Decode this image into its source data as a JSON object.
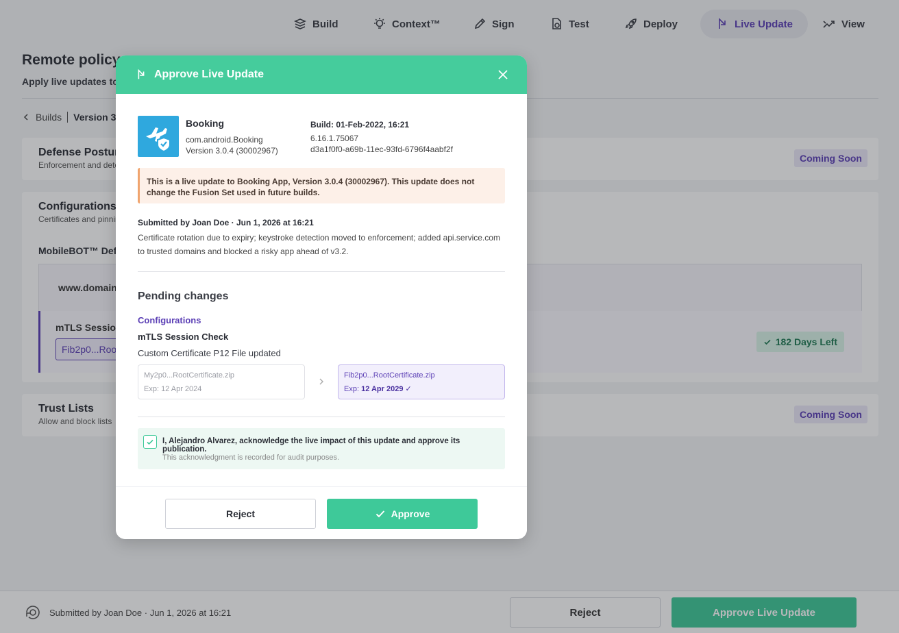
{
  "nav": {
    "items": [
      {
        "label": "Build",
        "icon": "build-icon"
      },
      {
        "label": "Context™",
        "icon": "bulb-icon"
      },
      {
        "label": "Sign",
        "icon": "pen-icon"
      },
      {
        "label": "Test",
        "icon": "test-icon"
      },
      {
        "label": "Deploy",
        "icon": "rocket-icon"
      },
      {
        "label": "Live Update",
        "icon": "live-update-icon",
        "active": true
      },
      {
        "label": "View",
        "icon": "view-icon"
      }
    ]
  },
  "page": {
    "title": "Remote policy m",
    "subtitle": "Apply live updates to c",
    "breadcrumb": {
      "back": "Builds",
      "current": "Version 3"
    }
  },
  "cards": {
    "defense": {
      "title": "Defense Posture",
      "subtitle": "Enforcement and dete",
      "badge": "Coming Soon"
    },
    "configs": {
      "title": "Configurations",
      "subtitle": "Certificates and pinnin",
      "section": "MobileBOT™ Defe",
      "domain": "www.domain-",
      "mtls_title": "mTLS Session",
      "mtls_file": "Fib2p0...Root",
      "days_left": "182 Days Left"
    },
    "trust": {
      "title": "Trust Lists",
      "subtitle": "Allow and block lists",
      "badge": "Coming Soon"
    }
  },
  "bottombar": {
    "submitted": "Submitted by Joan Doe · Jun 1, 2026 at 16:21",
    "reject": "Reject",
    "approve": "Approve Live Update"
  },
  "modal": {
    "title": "Approve Live Update",
    "app": {
      "name": "Booking",
      "package": "com.android.Booking",
      "version": "Version 3.0.4 (30002967)",
      "build_date": "Build: 01-Feb-2022, 16:21",
      "build_number": "6.16.1.75067",
      "build_id": "d3a1f0f0-a69b-11ec-93fd-6796f4aabf2f"
    },
    "notice": "This is a live update to Booking App, Version 3.0.4 (30002967). This update does not change the Fusion Set used in future builds.",
    "submitted": "Submitted by Joan Doe · Jun 1, 2026 at 16:21",
    "summary": "Certificate rotation due to expiry; keystroke detection moved to enforcement; added api.service.com to trusted domains and blocked a risky app ahead of v3.2.",
    "pending_heading": "Pending changes",
    "section": "Configurations",
    "check_name": "mTLS Session Check",
    "change_desc": "Custom Certificate P12 File updated",
    "old_file": {
      "name": "My2p0...RootCertificate.zip",
      "exp": "Exp: 12 Apr 2024"
    },
    "new_file": {
      "name": "Fib2p0...RootCertificate.zip",
      "exp_label": "Exp:",
      "exp_value": "12 Apr 2029 ✓"
    },
    "ack_text": "I, Alejandro Alvarez,  acknowledge the live impact of this update and approve its publication.",
    "ack_note": "This acknowledgment is recorded for audit purposes.",
    "ack_checked": true,
    "reject": "Reject",
    "approve": "Approve"
  },
  "colors": {
    "accent_green": "#45cc9c",
    "accent_purple": "#5b3fb5",
    "notice_bg": "#fdf0e8",
    "app_icon_bg": "#2fa8de"
  }
}
